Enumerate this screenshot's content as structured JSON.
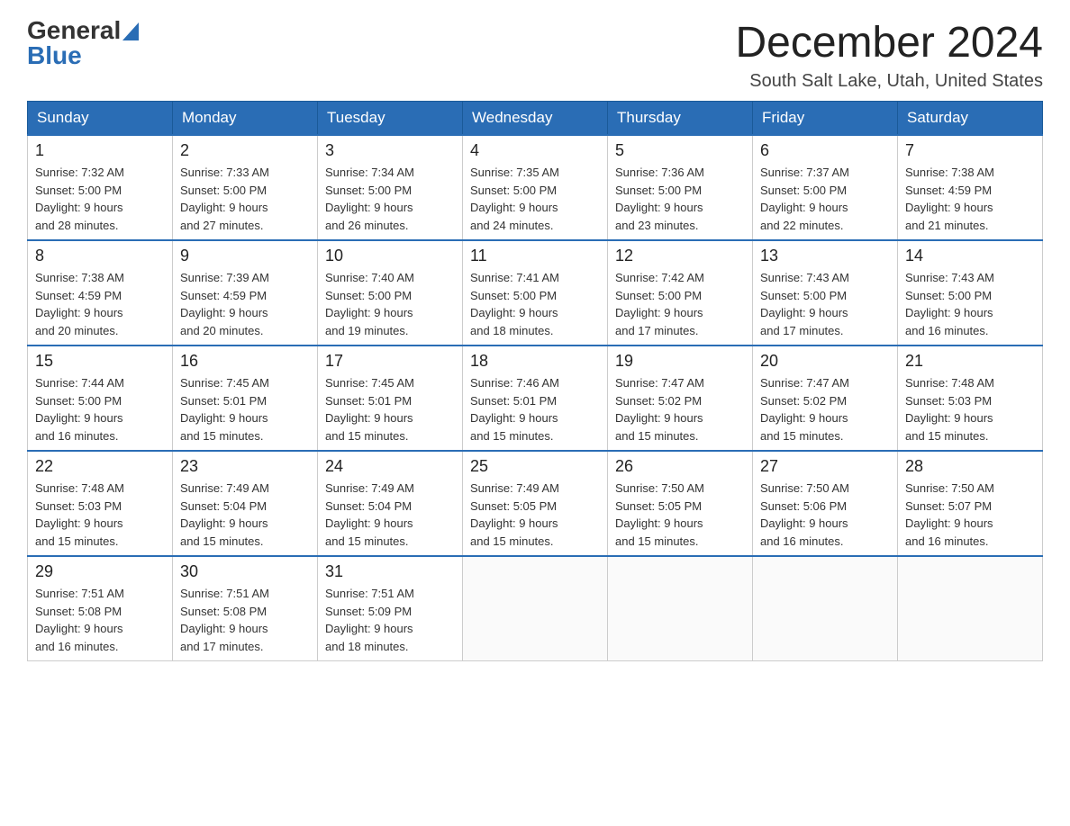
{
  "header": {
    "logo": {
      "general": "General",
      "blue": "Blue"
    },
    "title": "December 2024",
    "location": "South Salt Lake, Utah, United States"
  },
  "weekdays": [
    "Sunday",
    "Monday",
    "Tuesday",
    "Wednesday",
    "Thursday",
    "Friday",
    "Saturday"
  ],
  "weeks": [
    [
      {
        "day": "1",
        "sunrise": "7:32 AM",
        "sunset": "5:00 PM",
        "daylight": "9 hours and 28 minutes."
      },
      {
        "day": "2",
        "sunrise": "7:33 AM",
        "sunset": "5:00 PM",
        "daylight": "9 hours and 27 minutes."
      },
      {
        "day": "3",
        "sunrise": "7:34 AM",
        "sunset": "5:00 PM",
        "daylight": "9 hours and 26 minutes."
      },
      {
        "day": "4",
        "sunrise": "7:35 AM",
        "sunset": "5:00 PM",
        "daylight": "9 hours and 24 minutes."
      },
      {
        "day": "5",
        "sunrise": "7:36 AM",
        "sunset": "5:00 PM",
        "daylight": "9 hours and 23 minutes."
      },
      {
        "day": "6",
        "sunrise": "7:37 AM",
        "sunset": "5:00 PM",
        "daylight": "9 hours and 22 minutes."
      },
      {
        "day": "7",
        "sunrise": "7:38 AM",
        "sunset": "4:59 PM",
        "daylight": "9 hours and 21 minutes."
      }
    ],
    [
      {
        "day": "8",
        "sunrise": "7:38 AM",
        "sunset": "4:59 PM",
        "daylight": "9 hours and 20 minutes."
      },
      {
        "day": "9",
        "sunrise": "7:39 AM",
        "sunset": "4:59 PM",
        "daylight": "9 hours and 20 minutes."
      },
      {
        "day": "10",
        "sunrise": "7:40 AM",
        "sunset": "5:00 PM",
        "daylight": "9 hours and 19 minutes."
      },
      {
        "day": "11",
        "sunrise": "7:41 AM",
        "sunset": "5:00 PM",
        "daylight": "9 hours and 18 minutes."
      },
      {
        "day": "12",
        "sunrise": "7:42 AM",
        "sunset": "5:00 PM",
        "daylight": "9 hours and 17 minutes."
      },
      {
        "day": "13",
        "sunrise": "7:43 AM",
        "sunset": "5:00 PM",
        "daylight": "9 hours and 17 minutes."
      },
      {
        "day": "14",
        "sunrise": "7:43 AM",
        "sunset": "5:00 PM",
        "daylight": "9 hours and 16 minutes."
      }
    ],
    [
      {
        "day": "15",
        "sunrise": "7:44 AM",
        "sunset": "5:00 PM",
        "daylight": "9 hours and 16 minutes."
      },
      {
        "day": "16",
        "sunrise": "7:45 AM",
        "sunset": "5:01 PM",
        "daylight": "9 hours and 15 minutes."
      },
      {
        "day": "17",
        "sunrise": "7:45 AM",
        "sunset": "5:01 PM",
        "daylight": "9 hours and 15 minutes."
      },
      {
        "day": "18",
        "sunrise": "7:46 AM",
        "sunset": "5:01 PM",
        "daylight": "9 hours and 15 minutes."
      },
      {
        "day": "19",
        "sunrise": "7:47 AM",
        "sunset": "5:02 PM",
        "daylight": "9 hours and 15 minutes."
      },
      {
        "day": "20",
        "sunrise": "7:47 AM",
        "sunset": "5:02 PM",
        "daylight": "9 hours and 15 minutes."
      },
      {
        "day": "21",
        "sunrise": "7:48 AM",
        "sunset": "5:03 PM",
        "daylight": "9 hours and 15 minutes."
      }
    ],
    [
      {
        "day": "22",
        "sunrise": "7:48 AM",
        "sunset": "5:03 PM",
        "daylight": "9 hours and 15 minutes."
      },
      {
        "day": "23",
        "sunrise": "7:49 AM",
        "sunset": "5:04 PM",
        "daylight": "9 hours and 15 minutes."
      },
      {
        "day": "24",
        "sunrise": "7:49 AM",
        "sunset": "5:04 PM",
        "daylight": "9 hours and 15 minutes."
      },
      {
        "day": "25",
        "sunrise": "7:49 AM",
        "sunset": "5:05 PM",
        "daylight": "9 hours and 15 minutes."
      },
      {
        "day": "26",
        "sunrise": "7:50 AM",
        "sunset": "5:05 PM",
        "daylight": "9 hours and 15 minutes."
      },
      {
        "day": "27",
        "sunrise": "7:50 AM",
        "sunset": "5:06 PM",
        "daylight": "9 hours and 16 minutes."
      },
      {
        "day": "28",
        "sunrise": "7:50 AM",
        "sunset": "5:07 PM",
        "daylight": "9 hours and 16 minutes."
      }
    ],
    [
      {
        "day": "29",
        "sunrise": "7:51 AM",
        "sunset": "5:08 PM",
        "daylight": "9 hours and 16 minutes."
      },
      {
        "day": "30",
        "sunrise": "7:51 AM",
        "sunset": "5:08 PM",
        "daylight": "9 hours and 17 minutes."
      },
      {
        "day": "31",
        "sunrise": "7:51 AM",
        "sunset": "5:09 PM",
        "daylight": "9 hours and 18 minutes."
      },
      null,
      null,
      null,
      null
    ]
  ]
}
